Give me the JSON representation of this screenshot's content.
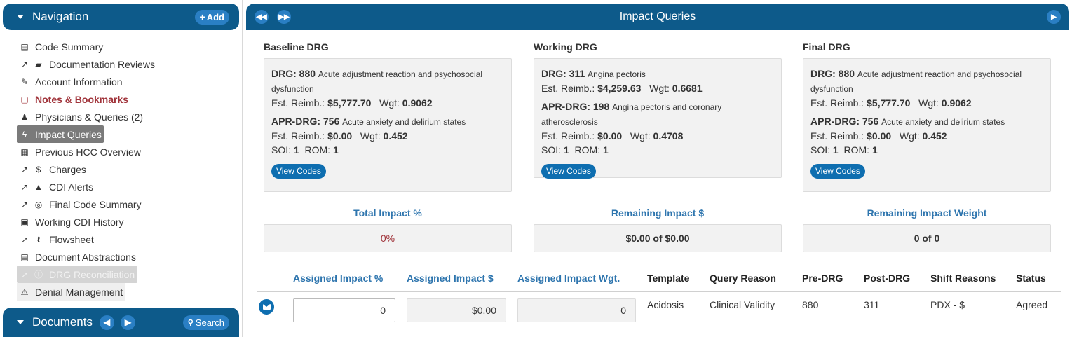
{
  "nav": {
    "title": "Navigation",
    "add_label": "Add",
    "items": [
      {
        "label": "Code Summary",
        "icon": "newspaper-icon",
        "glyph": "▤"
      },
      {
        "label": "Documentation Reviews",
        "icon": "book-icon",
        "glyph": "▰",
        "external": true
      },
      {
        "label": "Account Information",
        "icon": "pencil-icon",
        "glyph": "✎"
      },
      {
        "label": "Notes & Bookmarks",
        "icon": "sticky-note-icon",
        "glyph": "▢"
      },
      {
        "label": "Physicians & Queries (2)",
        "icon": "user-md-icon",
        "glyph": "♟"
      },
      {
        "label": "Impact Queries",
        "icon": "bolt-icon",
        "glyph": "ϟ"
      },
      {
        "label": "Previous HCC Overview",
        "icon": "calendar-icon",
        "glyph": "▦"
      },
      {
        "label": "Charges",
        "icon": "dollar-icon",
        "glyph": "$",
        "external": true
      },
      {
        "label": "CDI Alerts",
        "icon": "bell-icon",
        "glyph": "▲",
        "external": true
      },
      {
        "label": "Final Code Summary",
        "icon": "bullseye-icon",
        "glyph": "◎",
        "external": true
      },
      {
        "label": "Working CDI History",
        "icon": "calendar-check-icon",
        "glyph": "▣"
      },
      {
        "label": "Flowsheet",
        "icon": "thermometer-icon",
        "glyph": "ℓ",
        "external": true
      },
      {
        "label": "Document Abstractions",
        "icon": "list-alt-icon",
        "glyph": "▤"
      },
      {
        "label": "DRG Reconciliation",
        "icon": "info-icon",
        "glyph": "ⓘ",
        "external": true
      },
      {
        "label": "Denial Management",
        "icon": "warning-icon",
        "glyph": "⚠"
      }
    ]
  },
  "documents": {
    "title": "Documents",
    "search_label": "Search"
  },
  "main": {
    "title": "Impact Queries"
  },
  "drg": {
    "baseline": {
      "heading": "Baseline DRG",
      "drg_code": "880",
      "drg_desc": "Acute adjustment reaction and psychosocial dysfunction",
      "reimb": "$5,777.70",
      "wgt": "0.9062",
      "apr_code": "756",
      "apr_desc": "Acute anxiety and delirium states",
      "apr_reimb": "$0.00",
      "apr_wgt": "0.452",
      "soi": "1",
      "rom": "1"
    },
    "working": {
      "heading": "Working DRG",
      "drg_code": "311",
      "drg_desc": "Angina pectoris",
      "reimb": "$4,259.63",
      "wgt": "0.6681",
      "apr_code": "198",
      "apr_desc": "Angina pectoris and coronary atherosclerosis",
      "apr_reimb": "$0.00",
      "apr_wgt": "0.4708",
      "soi": "1",
      "rom": "1"
    },
    "final": {
      "heading": "Final DRG",
      "drg_code": "880",
      "drg_desc": "Acute adjustment reaction and psychosocial dysfunction",
      "reimb": "$5,777.70",
      "wgt": "0.9062",
      "apr_code": "756",
      "apr_desc": "Acute anxiety and delirium states",
      "apr_reimb": "$0.00",
      "apr_wgt": "0.452",
      "soi": "1",
      "rom": "1"
    },
    "labels": {
      "drg": "DRG:",
      "apr": "APR-DRG:",
      "reimb": "Est. Reimb.:",
      "wgt": "Wgt:",
      "soi": "SOI:",
      "rom": "ROM:",
      "view_codes": "View Codes"
    }
  },
  "impact": {
    "total_pct_label": "Total Impact %",
    "total_pct_value": "0%",
    "remaining_dollar_label": "Remaining Impact $",
    "remaining_dollar_value": "$0.00 of $0.00",
    "remaining_wgt_label": "Remaining Impact Weight",
    "remaining_wgt_value": "0 of 0"
  },
  "table": {
    "headers": {
      "assigned_pct": "Assigned Impact %",
      "assigned_dollar": "Assigned Impact $",
      "assigned_wgt": "Assigned Impact Wgt.",
      "template": "Template",
      "query_reason": "Query Reason",
      "pre_drg": "Pre-DRG",
      "post_drg": "Post-DRG",
      "shift_reasons": "Shift Reasons",
      "status": "Status"
    },
    "rows": [
      {
        "assigned_pct": "0",
        "assigned_dollar": "$0.00",
        "assigned_wgt": "0",
        "template": "Acidosis",
        "query_reason": "Clinical Validity",
        "pre_drg": "880",
        "post_drg": "311",
        "shift_reasons": "PDX - $",
        "status": "Agreed"
      }
    ]
  },
  "colors": {
    "header_bg": "#0d5a8a",
    "accent_blue": "#2e75ae",
    "button_blue": "#0e6eb0",
    "notes_red": "#a0333a",
    "active_gray": "#7a7a7a"
  }
}
